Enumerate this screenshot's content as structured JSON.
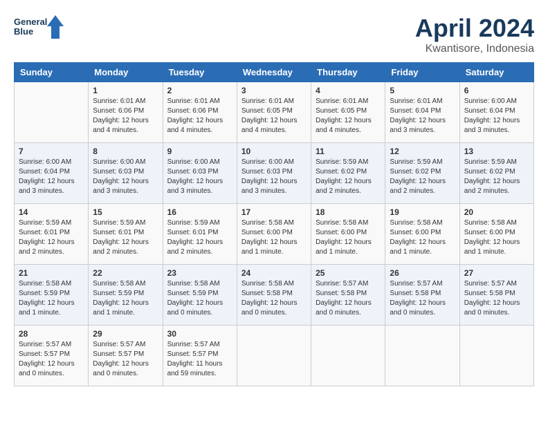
{
  "header": {
    "logo_line1": "General",
    "logo_line2": "Blue",
    "month": "April 2024",
    "location": "Kwantisore, Indonesia"
  },
  "weekdays": [
    "Sunday",
    "Monday",
    "Tuesday",
    "Wednesday",
    "Thursday",
    "Friday",
    "Saturday"
  ],
  "weeks": [
    [
      {
        "day": "",
        "info": ""
      },
      {
        "day": "1",
        "info": "Sunrise: 6:01 AM\nSunset: 6:06 PM\nDaylight: 12 hours\nand 4 minutes."
      },
      {
        "day": "2",
        "info": "Sunrise: 6:01 AM\nSunset: 6:06 PM\nDaylight: 12 hours\nand 4 minutes."
      },
      {
        "day": "3",
        "info": "Sunrise: 6:01 AM\nSunset: 6:05 PM\nDaylight: 12 hours\nand 4 minutes."
      },
      {
        "day": "4",
        "info": "Sunrise: 6:01 AM\nSunset: 6:05 PM\nDaylight: 12 hours\nand 4 minutes."
      },
      {
        "day": "5",
        "info": "Sunrise: 6:01 AM\nSunset: 6:04 PM\nDaylight: 12 hours\nand 3 minutes."
      },
      {
        "day": "6",
        "info": "Sunrise: 6:00 AM\nSunset: 6:04 PM\nDaylight: 12 hours\nand 3 minutes."
      }
    ],
    [
      {
        "day": "7",
        "info": "Sunrise: 6:00 AM\nSunset: 6:04 PM\nDaylight: 12 hours\nand 3 minutes."
      },
      {
        "day": "8",
        "info": "Sunrise: 6:00 AM\nSunset: 6:03 PM\nDaylight: 12 hours\nand 3 minutes."
      },
      {
        "day": "9",
        "info": "Sunrise: 6:00 AM\nSunset: 6:03 PM\nDaylight: 12 hours\nand 3 minutes."
      },
      {
        "day": "10",
        "info": "Sunrise: 6:00 AM\nSunset: 6:03 PM\nDaylight: 12 hours\nand 3 minutes."
      },
      {
        "day": "11",
        "info": "Sunrise: 5:59 AM\nSunset: 6:02 PM\nDaylight: 12 hours\nand 2 minutes."
      },
      {
        "day": "12",
        "info": "Sunrise: 5:59 AM\nSunset: 6:02 PM\nDaylight: 12 hours\nand 2 minutes."
      },
      {
        "day": "13",
        "info": "Sunrise: 5:59 AM\nSunset: 6:02 PM\nDaylight: 12 hours\nand 2 minutes."
      }
    ],
    [
      {
        "day": "14",
        "info": "Sunrise: 5:59 AM\nSunset: 6:01 PM\nDaylight: 12 hours\nand 2 minutes."
      },
      {
        "day": "15",
        "info": "Sunrise: 5:59 AM\nSunset: 6:01 PM\nDaylight: 12 hours\nand 2 minutes."
      },
      {
        "day": "16",
        "info": "Sunrise: 5:59 AM\nSunset: 6:01 PM\nDaylight: 12 hours\nand 2 minutes."
      },
      {
        "day": "17",
        "info": "Sunrise: 5:58 AM\nSunset: 6:00 PM\nDaylight: 12 hours\nand 1 minute."
      },
      {
        "day": "18",
        "info": "Sunrise: 5:58 AM\nSunset: 6:00 PM\nDaylight: 12 hours\nand 1 minute."
      },
      {
        "day": "19",
        "info": "Sunrise: 5:58 AM\nSunset: 6:00 PM\nDaylight: 12 hours\nand 1 minute."
      },
      {
        "day": "20",
        "info": "Sunrise: 5:58 AM\nSunset: 6:00 PM\nDaylight: 12 hours\nand 1 minute."
      }
    ],
    [
      {
        "day": "21",
        "info": "Sunrise: 5:58 AM\nSunset: 5:59 PM\nDaylight: 12 hours\nand 1 minute."
      },
      {
        "day": "22",
        "info": "Sunrise: 5:58 AM\nSunset: 5:59 PM\nDaylight: 12 hours\nand 1 minute."
      },
      {
        "day": "23",
        "info": "Sunrise: 5:58 AM\nSunset: 5:59 PM\nDaylight: 12 hours\nand 0 minutes."
      },
      {
        "day": "24",
        "info": "Sunrise: 5:58 AM\nSunset: 5:58 PM\nDaylight: 12 hours\nand 0 minutes."
      },
      {
        "day": "25",
        "info": "Sunrise: 5:57 AM\nSunset: 5:58 PM\nDaylight: 12 hours\nand 0 minutes."
      },
      {
        "day": "26",
        "info": "Sunrise: 5:57 AM\nSunset: 5:58 PM\nDaylight: 12 hours\nand 0 minutes."
      },
      {
        "day": "27",
        "info": "Sunrise: 5:57 AM\nSunset: 5:58 PM\nDaylight: 12 hours\nand 0 minutes."
      }
    ],
    [
      {
        "day": "28",
        "info": "Sunrise: 5:57 AM\nSunset: 5:57 PM\nDaylight: 12 hours\nand 0 minutes."
      },
      {
        "day": "29",
        "info": "Sunrise: 5:57 AM\nSunset: 5:57 PM\nDaylight: 12 hours\nand 0 minutes."
      },
      {
        "day": "30",
        "info": "Sunrise: 5:57 AM\nSunset: 5:57 PM\nDaylight: 11 hours\nand 59 minutes."
      },
      {
        "day": "",
        "info": ""
      },
      {
        "day": "",
        "info": ""
      },
      {
        "day": "",
        "info": ""
      },
      {
        "day": "",
        "info": ""
      }
    ]
  ]
}
